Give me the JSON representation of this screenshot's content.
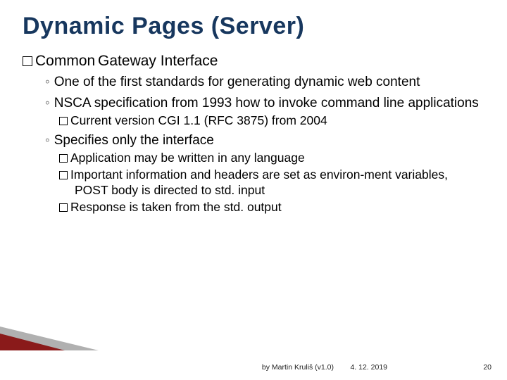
{
  "title": "Dynamic Pages (Server)",
  "heading": {
    "lead": "Common",
    "rest": "Gateway Interface"
  },
  "bullets": {
    "b1": "One of the first standards for generating dynamic web content",
    "b2": "NSCA specification from 1993 how to invoke command line applications",
    "b2a": "Current version CGI 1.1 (RFC 3875) from 2004",
    "b3": "Specifies only the interface",
    "b3a": "Application may be written in any language",
    "b3b": "Important information and headers are set as environ-ment variables, POST body is directed to std. input",
    "b3c": "Response is taken from the std. output"
  },
  "footer": {
    "author": "by Martin Kruliš (v1.0)",
    "date": "4. 12. 2019",
    "page": "20"
  }
}
